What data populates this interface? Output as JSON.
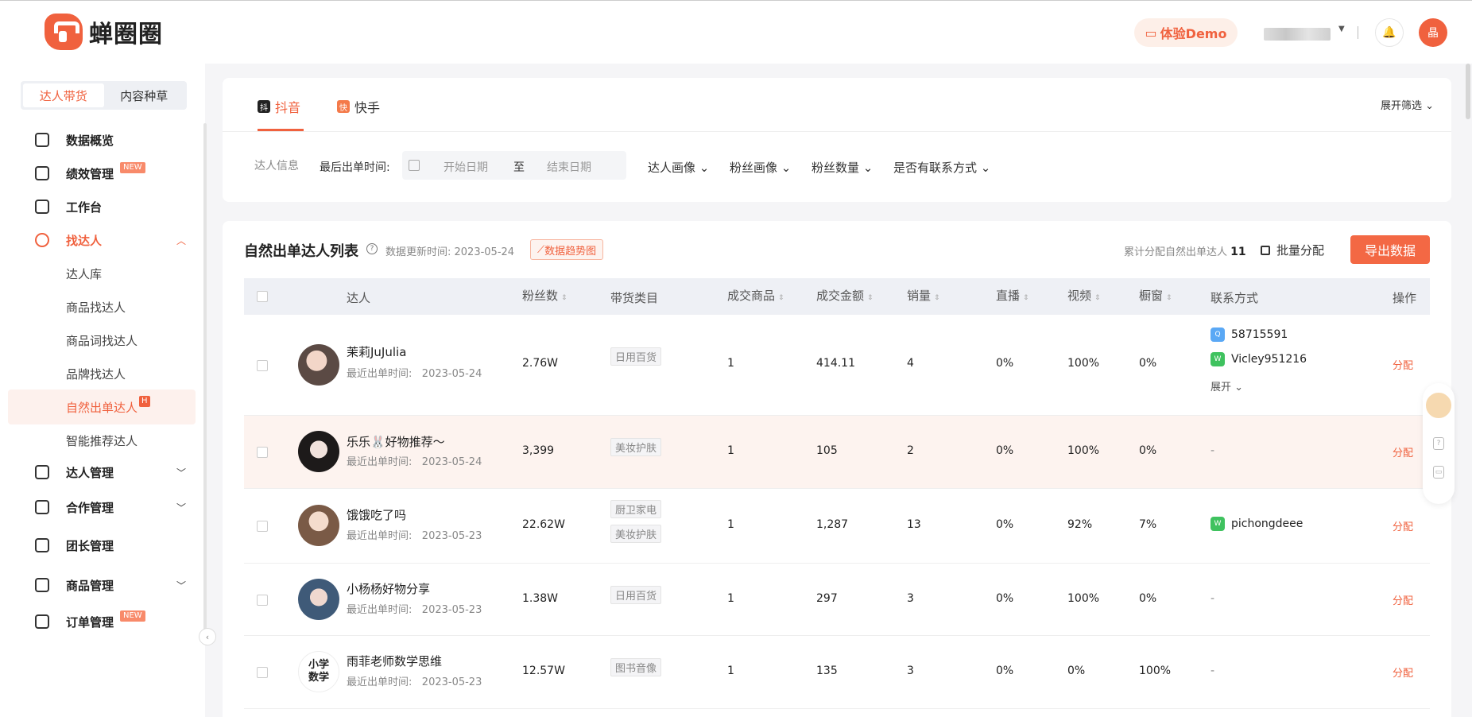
{
  "header": {
    "logo_text": "蝉圈圈",
    "demo_label": "体验Demo",
    "avatar_text": "晶"
  },
  "sidebar": {
    "segments": [
      "达人带货",
      "内容种草"
    ],
    "items": {
      "overview": "数据概览",
      "performance": "绩效管理",
      "workbench": "工作台",
      "find": "找达人",
      "sub_library": "达人库",
      "sub_by_product": "商品找达人",
      "sub_by_keyword": "商品词找达人",
      "sub_by_brand": "品牌找达人",
      "sub_natural": "自然出单达人",
      "sub_smart": "智能推荐达人",
      "talent_mgmt": "达人管理",
      "coop_mgmt": "合作管理",
      "leader_mgmt": "团长管理",
      "product_mgmt": "商品管理",
      "order_mgmt": "订单管理"
    },
    "tag_new": "NEW",
    "tag_h": "H"
  },
  "filter": {
    "tabs": [
      "抖音",
      "快手"
    ],
    "tab_icons": [
      "抖",
      "快"
    ],
    "expand": "展开筛选 ⌄",
    "info_label": "达人信息",
    "last_order_label": "最后出单时间:",
    "start_ph": "开始日期",
    "to": "至",
    "end_ph": "结束日期",
    "dropdowns": [
      "达人画像 ⌄",
      "粉丝画像 ⌄",
      "粉丝数量 ⌄",
      "是否有联系方式 ⌄"
    ]
  },
  "table": {
    "title": "自然出单达人列表",
    "update_text": "数据更新时间: 2023-05-24",
    "trend_btn": "数据趋势图",
    "cum_label": "累计分配自然出单达人",
    "cum_value": "11",
    "batch_label": "批量分配",
    "export_label": "导出数据",
    "columns": [
      "达人",
      "粉丝数",
      "带货类目",
      "成交商品",
      "成交金额",
      "销量",
      "直播",
      "视频",
      "橱窗",
      "联系方式",
      "操作"
    ],
    "last_order_prefix": "最近出单时间:",
    "expand_contact": "展开 ⌄",
    "assign": "分配",
    "rows": [
      {
        "name": "茉莉JuJulia",
        "date": "2023-05-24",
        "fans": "2.76W",
        "cats": [
          "日用百货"
        ],
        "goods": "1",
        "amount": "414.11",
        "sales": "4",
        "live": "0%",
        "video": "100%",
        "window": "0%",
        "contacts": [
          {
            "type": "qq",
            "value": "58715591"
          },
          {
            "type": "wx",
            "value": "Vicley951216"
          }
        ],
        "dash": ""
      },
      {
        "name": "乐乐🐰好物推荐～",
        "date": "2023-05-24",
        "fans": "3,399",
        "cats": [
          "美妆护肤"
        ],
        "goods": "1",
        "amount": "105",
        "sales": "2",
        "live": "0%",
        "video": "100%",
        "window": "0%",
        "contacts": [],
        "dash": "-"
      },
      {
        "name": "饿饿吃了吗",
        "date": "2023-05-23",
        "fans": "22.62W",
        "cats": [
          "厨卫家电",
          "美妆护肤"
        ],
        "goods": "1",
        "amount": "1,287",
        "sales": "13",
        "live": "0%",
        "video": "92%",
        "window": "7%",
        "contacts": [
          {
            "type": "wx",
            "value": "pichongdeee"
          }
        ],
        "dash": ""
      },
      {
        "name": "小杨杨好物分享",
        "date": "2023-05-23",
        "fans": "1.38W",
        "cats": [
          "日用百货"
        ],
        "goods": "1",
        "amount": "297",
        "sales": "3",
        "live": "0%",
        "video": "100%",
        "window": "0%",
        "contacts": [],
        "dash": "-"
      },
      {
        "name": "雨菲老师数学思维",
        "date": "2023-05-23",
        "fans": "12.57W",
        "cats": [
          "图书音像"
        ],
        "goods": "1",
        "amount": "135",
        "sales": "3",
        "live": "0%",
        "video": "0%",
        "window": "100%",
        "contacts": [],
        "dash": "-"
      }
    ],
    "avatar_text_row5": "小学数学"
  },
  "colors": {
    "accent": "#f0613e"
  }
}
